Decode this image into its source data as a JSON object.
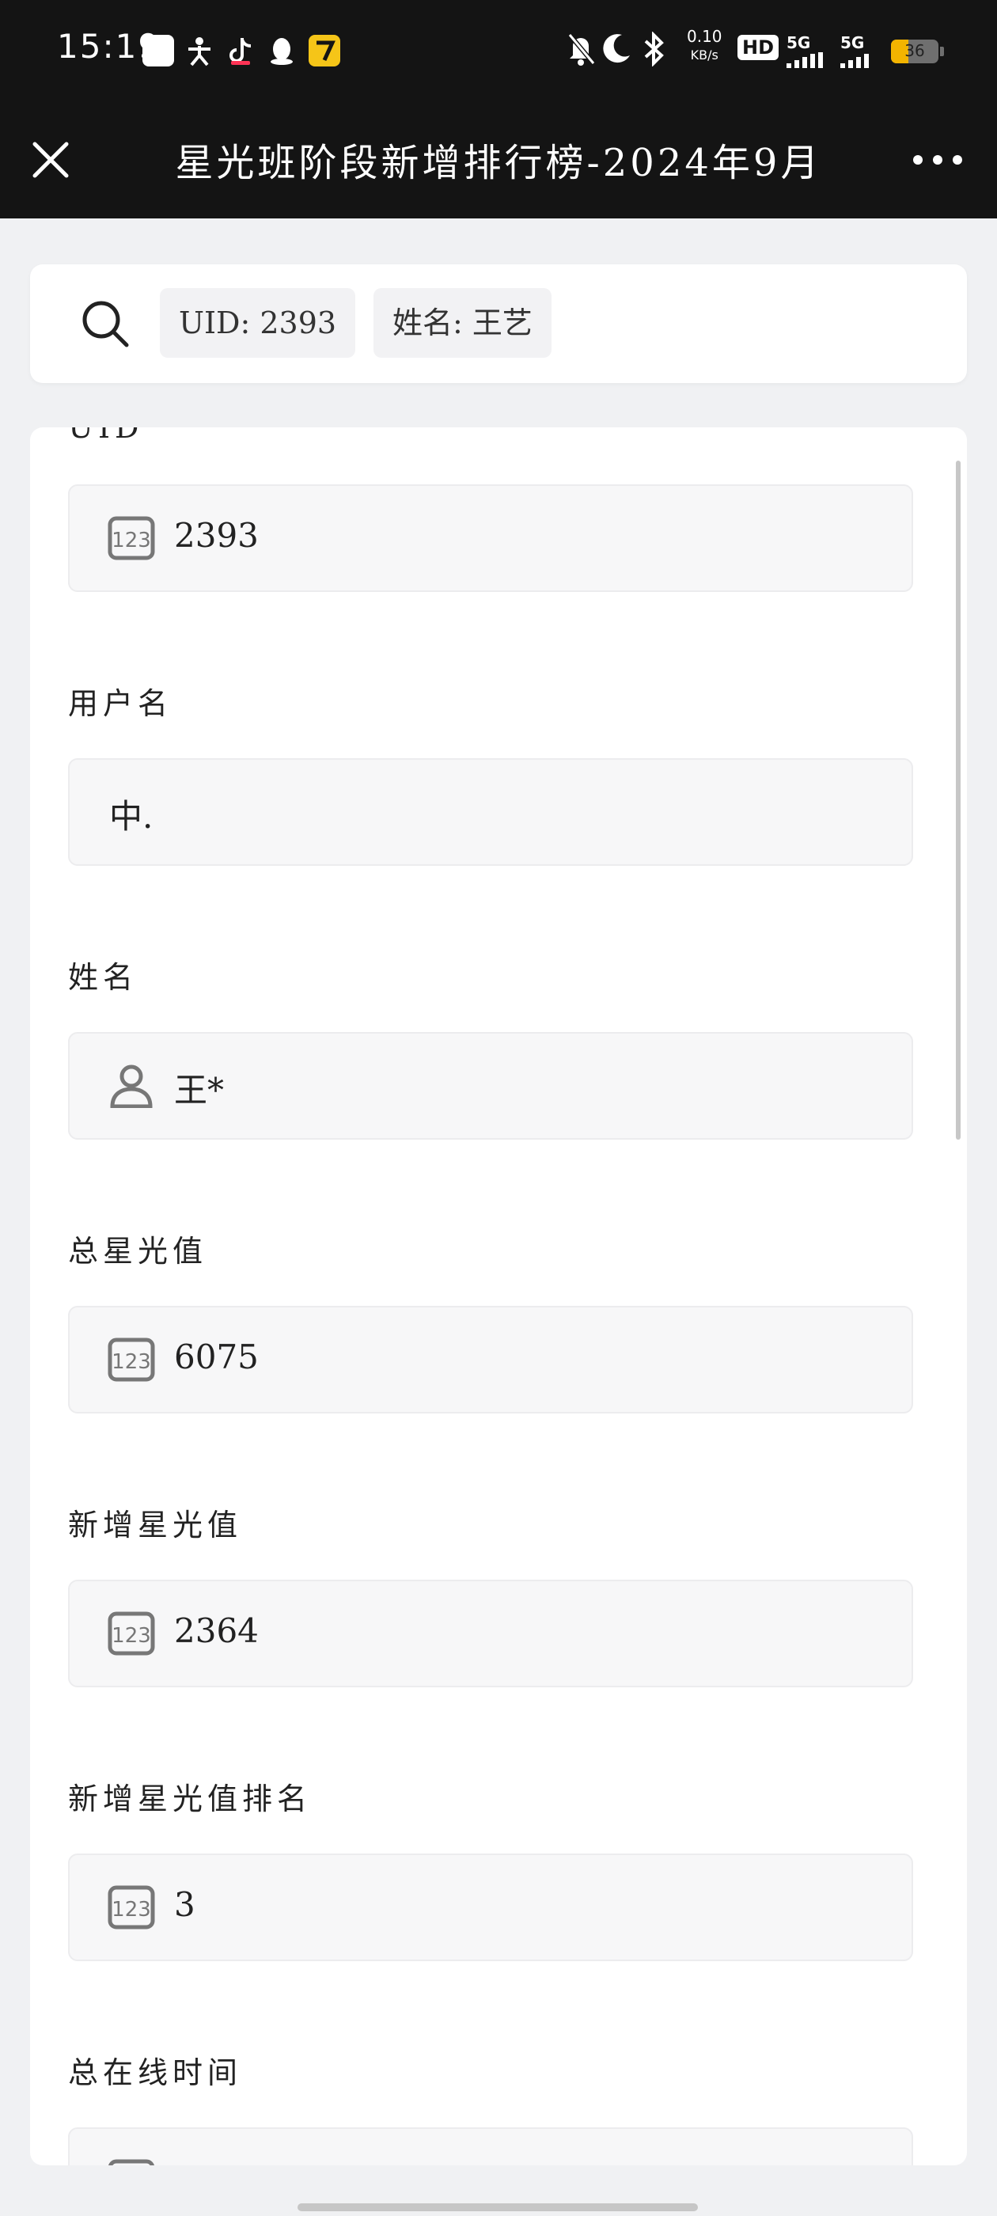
{
  "status_bar": {
    "time": "15:19",
    "net_speed_value": "0.10",
    "net_speed_unit": "KB/s",
    "hd": "HD",
    "signal1": "5G",
    "signal2": "5G",
    "battery": "36",
    "colors": {
      "battery": "#f3b400",
      "background": "#141414"
    }
  },
  "header": {
    "title": "星光班阶段新增排行榜-2024年9月"
  },
  "search": {
    "chip_uid": "UID: 2393",
    "chip_name": "姓名: 王艺"
  },
  "detail": {
    "partial_label": "UID",
    "fields": [
      {
        "label": "UID",
        "value": "2393",
        "icon": "number-icon"
      },
      {
        "label": "用户名",
        "value": "中.",
        "icon": ""
      },
      {
        "label": "姓名",
        "value": "王*",
        "icon": "person-icon"
      },
      {
        "label": "总星光值",
        "value": "6075",
        "icon": "number-icon"
      },
      {
        "label": "新增星光值",
        "value": "2364",
        "icon": "number-icon"
      },
      {
        "label": "新增星光值排名",
        "value": "3",
        "icon": "number-icon"
      },
      {
        "label": "总在线时间",
        "value": "",
        "icon": "number-icon"
      }
    ]
  }
}
